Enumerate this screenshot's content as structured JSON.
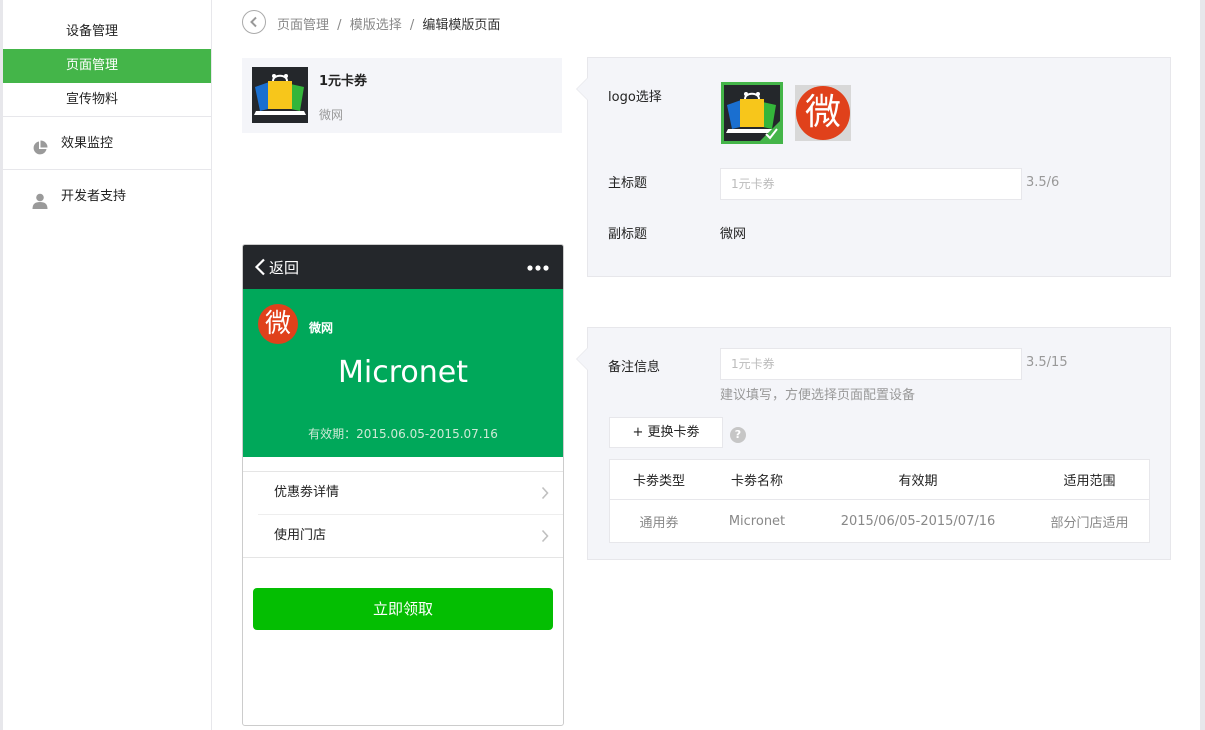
{
  "sidebar": {
    "sub_items": [
      {
        "label": "设备管理"
      },
      {
        "label": "页面管理",
        "active": true
      },
      {
        "label": "宣传物料"
      }
    ],
    "nav_items": [
      {
        "label": "效果监控",
        "icon": "pie-chart-icon"
      },
      {
        "label": "开发者支持",
        "icon": "user-icon"
      }
    ],
    "accent_color": "#44b549"
  },
  "breadcrumb": {
    "items": [
      "页面管理",
      "模版选择",
      "编辑模版页面"
    ],
    "separator": "/"
  },
  "card_summary": {
    "title": "1元卡券",
    "subtitle": "微网"
  },
  "phone": {
    "nav_back": "返回",
    "brand_logo_char": "微",
    "brand_name": "微网",
    "card_title": "Micronet",
    "validity": "有效期：2015.06.05-2015.07.16",
    "rows": [
      {
        "label": "优惠劵详情"
      },
      {
        "label": "使用门店"
      }
    ],
    "claim_button": "立即领取",
    "hero_color": "#00a85a",
    "button_color": "#04be02"
  },
  "basic_panel": {
    "logo_label": "logo选择",
    "logo_options": [
      {
        "name": "shopping-bag-logo",
        "selected": true
      },
      {
        "name": "wei-logo",
        "char": "微",
        "selected": false
      }
    ],
    "main_title_label": "主标题",
    "main_title_placeholder": "1元卡券",
    "main_title_counter": "3.5/6",
    "subtitle_label": "副标题",
    "subtitle_value": "微网"
  },
  "note_panel": {
    "label": "备注信息",
    "placeholder": "1元卡券",
    "counter": "3.5/15",
    "hint": "建议填写，方便选择页面配置设备",
    "change_button": "+ 更换卡劵",
    "help_char": "?",
    "table": {
      "headers": [
        "卡劵类型",
        "卡劵名称",
        "有效期",
        "适用范围"
      ],
      "rows": [
        [
          "通用券",
          "Micronet",
          "2015/06/05-2015/07/16",
          "部分门店适用"
        ]
      ]
    }
  }
}
